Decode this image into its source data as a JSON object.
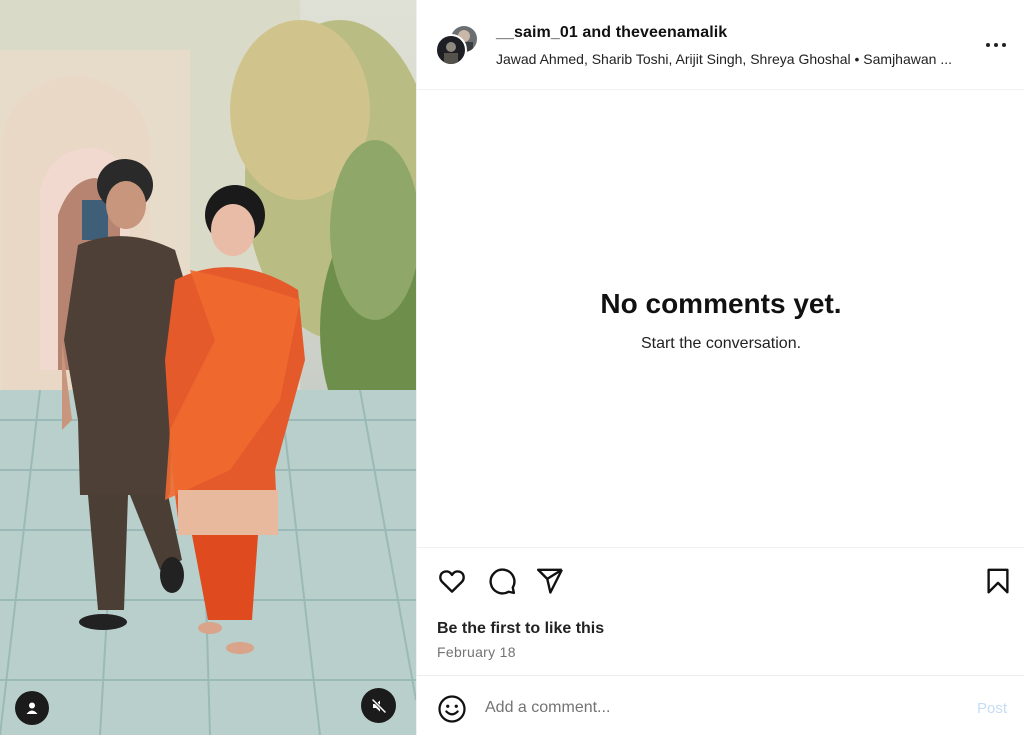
{
  "post": {
    "authors": "__saim_01 and theveenamalik",
    "audio": "Jawad Ahmed, Sharib Toshi, Arijit Singh, Shreya Ghoshal • Samjhawan ...",
    "more_icon": "more-horizontal-icon"
  },
  "comments": {
    "empty_title": "No comments yet.",
    "empty_subtitle": "Start the conversation."
  },
  "actions": {
    "like_icon": "heart-icon",
    "comment_icon": "comment-icon",
    "share_icon": "share-icon",
    "save_icon": "bookmark-icon",
    "likes_text": "Be the first to like this",
    "date": "February 18"
  },
  "composer": {
    "emoji_icon": "emoji-icon",
    "placeholder": "Add a comment...",
    "post_label": "Post"
  },
  "media": {
    "user_tag_icon": "user-icon",
    "mute_icon": "muted-speaker-icon"
  },
  "colors": {
    "post_disabled": "#c6dcf6",
    "muted_text": "#737373",
    "text": "#111111"
  }
}
